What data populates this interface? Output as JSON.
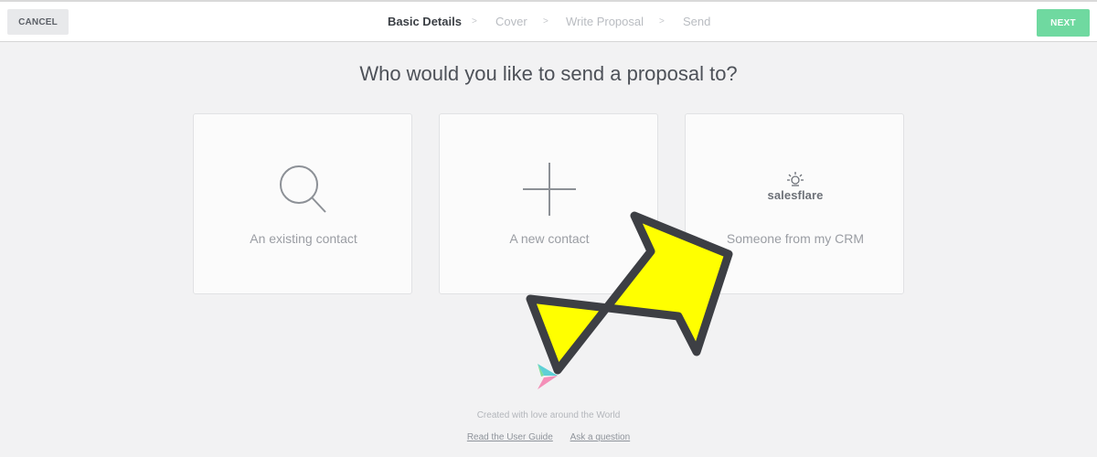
{
  "topbar": {
    "cancel_label": "CANCEL",
    "next_label": "NEXT",
    "steps": [
      {
        "label": "Basic Details",
        "active": true
      },
      {
        "label": "Cover",
        "active": false
      },
      {
        "label": "Write Proposal",
        "active": false
      },
      {
        "label": "Send",
        "active": false
      }
    ],
    "separator": ">"
  },
  "main": {
    "heading": "Who would you like to send a proposal to?",
    "options": [
      {
        "label": "An existing contact",
        "icon": "search-icon"
      },
      {
        "label": "A new contact",
        "icon": "plus-icon"
      },
      {
        "label": "Someone from my CRM",
        "icon": "salesflare-logo",
        "logo_text": "salesflare"
      }
    ]
  },
  "footer": {
    "tagline": "Created with love around the World",
    "links": [
      "Read the User Guide",
      "Ask a question"
    ]
  },
  "colors": {
    "next_button": "#6fd9a0",
    "arrow_fill": "#ffff00",
    "arrow_stroke": "#3d3f44",
    "background": "#f2f2f3"
  }
}
